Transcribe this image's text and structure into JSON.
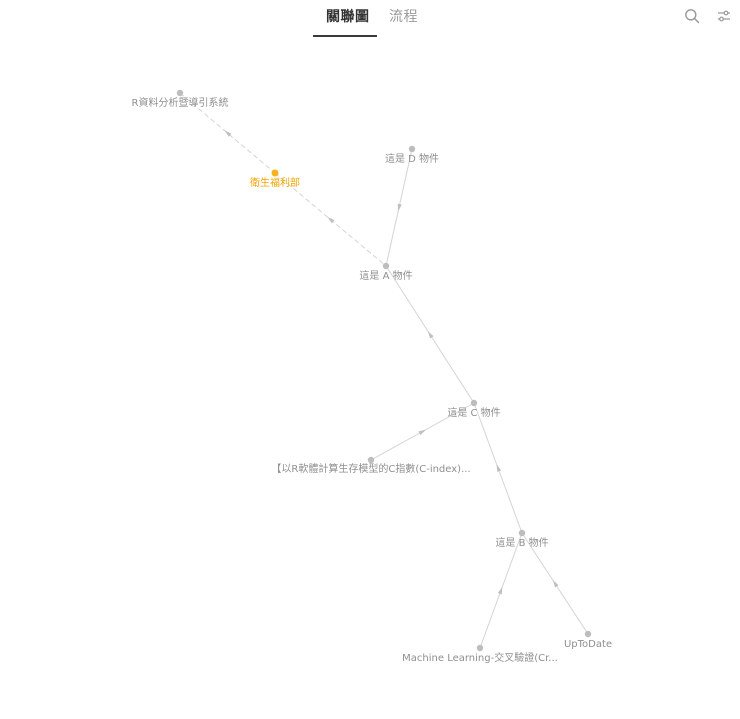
{
  "tabs": [
    {
      "label": "關聯圖",
      "active": true
    },
    {
      "label": "流程",
      "active": false
    }
  ],
  "toolbar": {
    "search_icon": "search-icon",
    "settings_icon": "sliders-icon"
  },
  "colors": {
    "node": "#bdbdbd",
    "node_active": "#f5b21a",
    "label": "#8f8f8f",
    "label_active": "#f0a500",
    "edge": "#d4d4d4"
  },
  "graph": {
    "nodes": [
      {
        "id": "r_system",
        "label": "R資料分析暨導引系統",
        "active": false
      },
      {
        "id": "welfare",
        "label": "衛生福利部",
        "active": true
      },
      {
        "id": "d_obj",
        "label": "這是 D 物件",
        "active": false
      },
      {
        "id": "a_obj",
        "label": "這是 A 物件",
        "active": false
      },
      {
        "id": "c_obj",
        "label": "這是 C 物件",
        "active": false
      },
      {
        "id": "cindex",
        "label": "【以R軟體計算生存模型的C指數(C-index)...",
        "active": false
      },
      {
        "id": "b_obj",
        "label": "這是 B 物件",
        "active": false
      },
      {
        "id": "ml",
        "label": "Machine Learning-交叉驗證(Cr...",
        "active": false
      },
      {
        "id": "uptodate",
        "label": "UpToDate",
        "active": false
      }
    ],
    "edges": [
      {
        "from": "r_system",
        "to": "welfare",
        "dashed": true
      },
      {
        "from": "welfare",
        "to": "a_obj",
        "dashed": true
      },
      {
        "from": "a_obj",
        "to": "d_obj",
        "dashed": false
      },
      {
        "from": "a_obj",
        "to": "c_obj",
        "dashed": false
      },
      {
        "from": "c_obj",
        "to": "cindex",
        "dashed": false
      },
      {
        "from": "c_obj",
        "to": "b_obj",
        "dashed": false
      },
      {
        "from": "b_obj",
        "to": "ml",
        "dashed": false
      },
      {
        "from": "b_obj",
        "to": "uptodate",
        "dashed": false
      }
    ]
  }
}
